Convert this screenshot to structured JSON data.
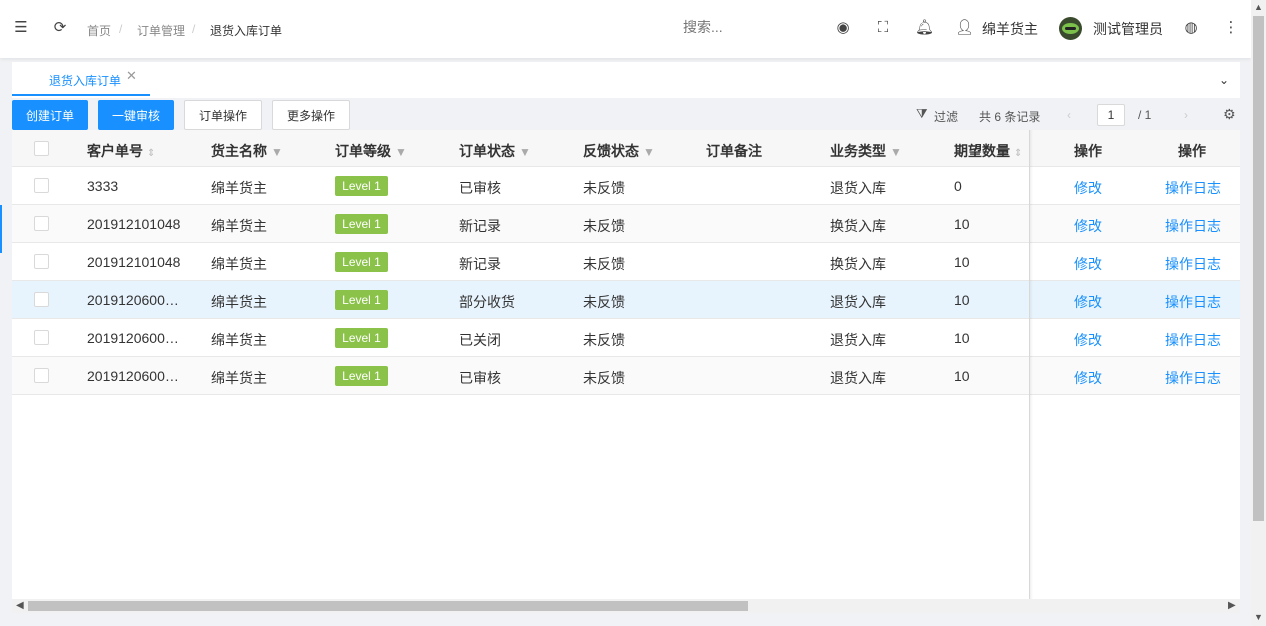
{
  "header": {
    "breadcrumb": [
      "首页",
      "订单管理",
      "退货入库订单"
    ],
    "search_placeholder": "搜索...",
    "shipper": "绵羊货主",
    "admin": "测试管理员"
  },
  "tabs": [
    {
      "label": "退货入库订单"
    }
  ],
  "toolbar": {
    "create": "创建订单",
    "approve": "一键审核",
    "order_ops": "订单操作",
    "more_ops": "更多操作",
    "filter": "过滤",
    "total": "共 6 条记录",
    "page_current": "1",
    "page_total": "/ 1"
  },
  "table": {
    "columns": [
      "客户单号",
      "货主名称",
      "订单等级",
      "订单状态",
      "反馈状态",
      "订单备注",
      "业务类型",
      "期望数量",
      "操作",
      "操作"
    ],
    "rows": [
      {
        "no": "3333",
        "owner": "绵羊货主",
        "level": "Level 1",
        "status": "已审核",
        "feedback": "未反馈",
        "remark": "",
        "biz": "退货入库",
        "qty": "0",
        "edit": "修改",
        "log": "操作日志"
      },
      {
        "no": "201912101048",
        "owner": "绵羊货主",
        "level": "Level 1",
        "status": "新记录",
        "feedback": "未反馈",
        "remark": "",
        "biz": "换货入库",
        "qty": "10",
        "edit": "修改",
        "log": "操作日志"
      },
      {
        "no": "201912101048",
        "owner": "绵羊货主",
        "level": "Level 1",
        "status": "新记录",
        "feedback": "未反馈",
        "remark": "",
        "biz": "换货入库",
        "qty": "10",
        "edit": "修改",
        "log": "操作日志"
      },
      {
        "no": "2019120600…",
        "owner": "绵羊货主",
        "level": "Level 1",
        "status": "部分收货",
        "feedback": "未反馈",
        "remark": "",
        "biz": "退货入库",
        "qty": "10",
        "edit": "修改",
        "log": "操作日志"
      },
      {
        "no": "2019120600…",
        "owner": "绵羊货主",
        "level": "Level 1",
        "status": "已关闭",
        "feedback": "未反馈",
        "remark": "",
        "biz": "退货入库",
        "qty": "10",
        "edit": "修改",
        "log": "操作日志"
      },
      {
        "no": "2019120600…",
        "owner": "绵羊货主",
        "level": "Level 1",
        "status": "已审核",
        "feedback": "未反馈",
        "remark": "",
        "biz": "退货入库",
        "qty": "10",
        "edit": "修改",
        "log": "操作日志"
      }
    ]
  },
  "colors": {
    "primary": "#1890ff",
    "tag": "#8bc34a",
    "highlight_row": "#e8f4fd"
  },
  "icons": [
    "menu-fold-icon",
    "refresh-icon",
    "record-icon",
    "fullscreen-icon",
    "bell-icon",
    "user-icon",
    "globe-icon",
    "more-vertical-icon",
    "chevron-down-icon",
    "close-icon",
    "filter-icon",
    "settings-icon",
    "sort-icon"
  ]
}
